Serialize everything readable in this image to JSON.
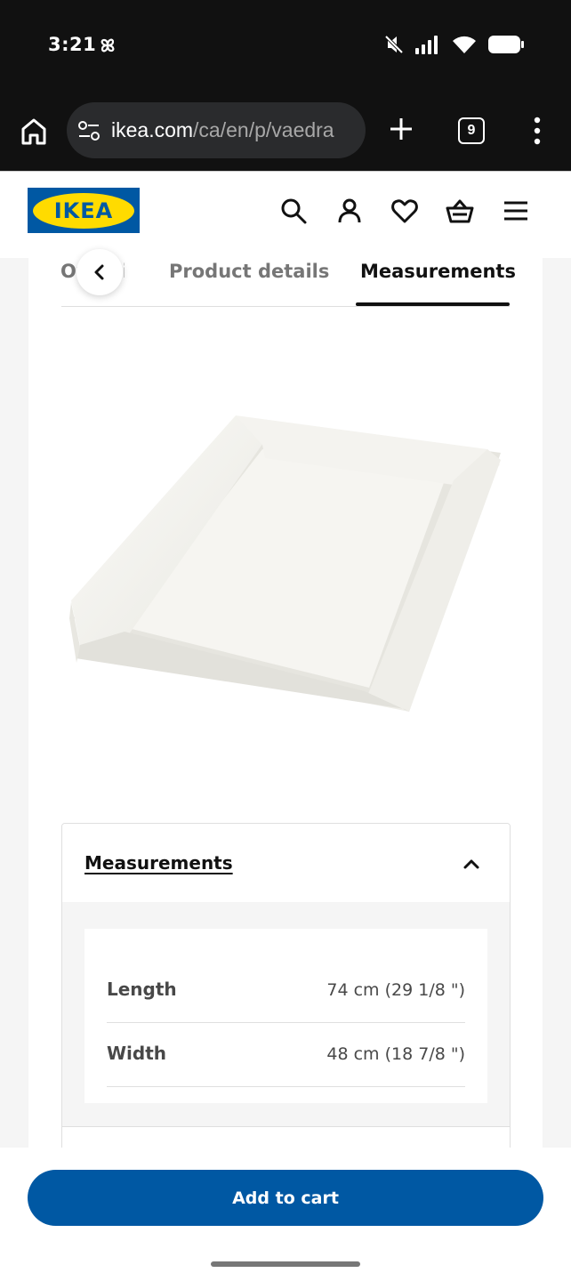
{
  "status_bar": {
    "time": "3:21",
    "icons": [
      "pinwheel-icon",
      "mute-icon",
      "signal-icon",
      "wifi-icon",
      "battery-icon"
    ]
  },
  "browser": {
    "url_host": "ikea.com",
    "url_path": "/ca/en/p/vaedra",
    "tab_count": "9",
    "icons": [
      "home-icon",
      "site-settings-icon",
      "plus-icon",
      "tabs-icon",
      "more-vert-icon"
    ]
  },
  "header": {
    "logo_text": "IKEA",
    "icons": [
      "search-icon",
      "account-icon",
      "heart-icon",
      "basket-icon",
      "hamburger-menu-icon"
    ],
    "brand_colors": {
      "blue": "#0058a3",
      "yellow": "#ffdb00"
    }
  },
  "tabs": {
    "items": [
      {
        "label": "Overview"
      },
      {
        "label": "Product details"
      },
      {
        "label": "Measurements"
      }
    ],
    "active_index": 2
  },
  "measurements": {
    "title": "Measurements",
    "rows": [
      {
        "label": "Length",
        "value": "74 cm (29 1/8 \")"
      },
      {
        "label": "Width",
        "value": "48 cm (18 7/8 \")"
      }
    ]
  },
  "cta": {
    "add_to_cart": "Add to cart",
    "color": "#0058a3"
  }
}
